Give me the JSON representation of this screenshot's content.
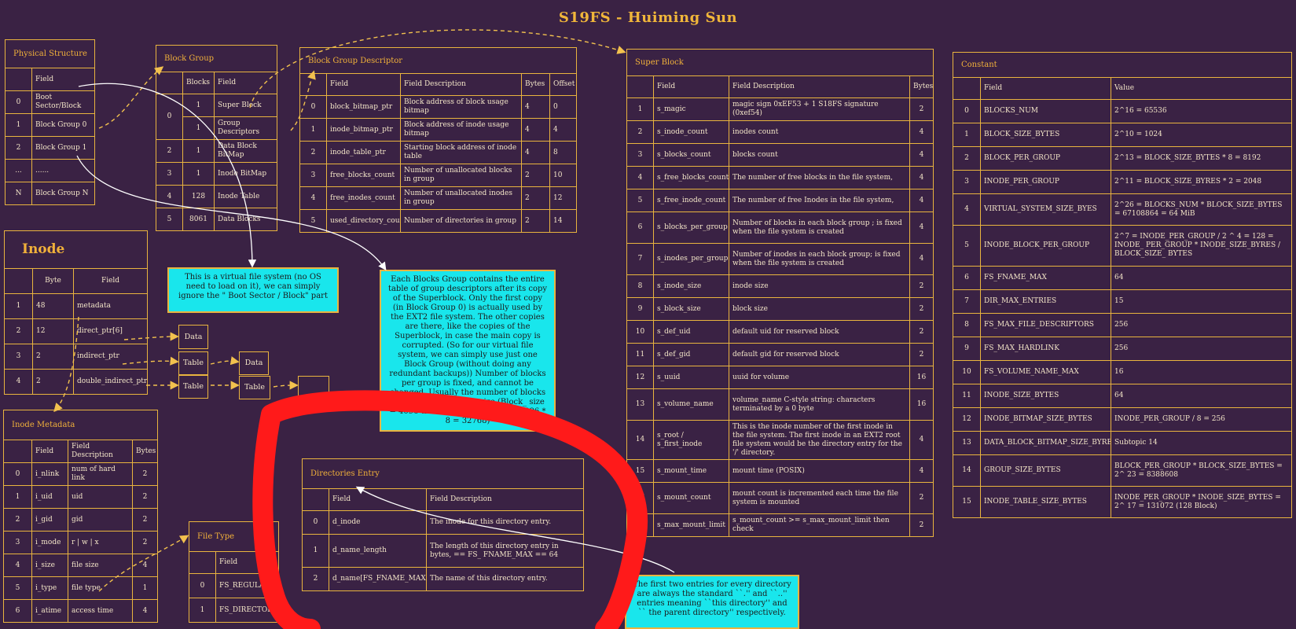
{
  "title": "S19FS - Huiming Sun",
  "physical": {
    "caption": "Physical Structure",
    "header": "Field",
    "rows": [
      {
        "idx": "0",
        "field": "Boot Sector/Block"
      },
      {
        "idx": "1",
        "field": "Block Group 0"
      },
      {
        "idx": "2",
        "field": "Block Group 1"
      },
      {
        "idx": "...",
        "field": "......"
      },
      {
        "idx": "N",
        "field": "Block Group N"
      }
    ]
  },
  "block_group": {
    "caption": "Block Group",
    "h_blocks": "Blocks",
    "h_field": "Field",
    "rows": [
      {
        "idx": "0",
        "blocks": "1",
        "field": "Super Block"
      },
      {
        "idx": "",
        "blocks": "1",
        "field": "Group Descriptors"
      },
      {
        "idx": "2",
        "blocks": "1",
        "field": "Data Block BitMap"
      },
      {
        "idx": "3",
        "blocks": "1",
        "field": "Inode BitMap"
      },
      {
        "idx": "4",
        "blocks": "128",
        "field": "Inode Table"
      },
      {
        "idx": "5",
        "blocks": "8061",
        "field": "Data Blocks"
      }
    ]
  },
  "bgd": {
    "caption": "Block Group Descriptor",
    "h_field": "Field",
    "h_desc": "Field Description",
    "h_bytes": "Bytes",
    "h_offset": "Offset",
    "rows": [
      {
        "idx": "0",
        "field": "block_bitmap_ptr",
        "desc": "Block address of block usage bitmap",
        "bytes": "4",
        "offset": "0"
      },
      {
        "idx": "1",
        "field": "inode_bitmap_ptr",
        "desc": "Block address of inode usage bitmap",
        "bytes": "4",
        "offset": "4"
      },
      {
        "idx": "2",
        "field": "inode_table_ptr",
        "desc": "Starting block address of inode table",
        "bytes": "4",
        "offset": "8"
      },
      {
        "idx": "3",
        "field": "free_blocks_count",
        "desc": "Number of unallocated blocks in group",
        "bytes": "2",
        "offset": "10"
      },
      {
        "idx": "4",
        "field": "free_inodes_count",
        "desc": "Number of unallocated inodes in group",
        "bytes": "2",
        "offset": "12"
      },
      {
        "idx": "5",
        "field": "used_directory_count",
        "desc": "Number of directories in group",
        "bytes": "2",
        "offset": "14"
      }
    ]
  },
  "super_block": {
    "caption": "Super Block",
    "h_field": "Field",
    "h_desc": "Field Description",
    "h_bytes": "Bytes",
    "rows": [
      {
        "idx": "1",
        "field": "s_magic",
        "desc": "magic sign 0xEF53 + 1 S18FS signature (0xef54)",
        "bytes": "2"
      },
      {
        "idx": "2",
        "field": "s_inode_count",
        "desc": "inodes count",
        "bytes": "4"
      },
      {
        "idx": "3",
        "field": "s_blocks_count",
        "desc": "blocks count",
        "bytes": "4"
      },
      {
        "idx": "4",
        "field": "s_free_blocks_count",
        "desc": "The number of free blocks in the file system,",
        "bytes": "4"
      },
      {
        "idx": "5",
        "field": "s_free_inode_count",
        "desc": "The number of free Inodes in the file system,",
        "bytes": "4"
      },
      {
        "idx": "6",
        "field": "s_blocks_per_group",
        "desc": "Number of blocks in each block group ; is fixed when the file system is created",
        "bytes": "4"
      },
      {
        "idx": "7",
        "field": "s_inodes_per_group",
        "desc": "Number of inodes in each block group; is fixed when the file system is created",
        "bytes": "4"
      },
      {
        "idx": "8",
        "field": "s_inode_size",
        "desc": "inode size",
        "bytes": "2"
      },
      {
        "idx": "9",
        "field": "s_block_size",
        "desc": "block size",
        "bytes": "2"
      },
      {
        "idx": "10",
        "field": "s_def_uid",
        "desc": "default uid for reserved block",
        "bytes": "2"
      },
      {
        "idx": "11",
        "field": "s_def_gid",
        "desc": "default gid for reserved block",
        "bytes": "2"
      },
      {
        "idx": "12",
        "field": "s_uuid",
        "desc": "uuid for volume",
        "bytes": "16"
      },
      {
        "idx": "13",
        "field": "s_volume_name",
        "desc": "volume_name C-style string: characters terminated by a 0 byte",
        "bytes": "16"
      },
      {
        "idx": "14",
        "field": "s_root / s_first_inode",
        "desc": "This is the inode number of the first inode in the file system. The first inode in an EXT2 root file system would be the directory entry for the '/' directory.",
        "bytes": "4"
      },
      {
        "idx": "15",
        "field": "s_mount_time",
        "desc": "mount time (POSIX)",
        "bytes": "4"
      },
      {
        "idx": "16",
        "field": "s_mount_count",
        "desc": "mount count is incremented each time the file system is mounted",
        "bytes": "2"
      },
      {
        "idx": "17",
        "field": "s_max_mount_limit",
        "desc": "s_mount_count >= s_max_mount_limit then check",
        "bytes": "2"
      }
    ]
  },
  "constant": {
    "caption": "Constant",
    "h_field": "Field",
    "h_value": "Value",
    "rows": [
      {
        "idx": "0",
        "field": "BLOCKS_NUM",
        "value": "2^16 = 65536"
      },
      {
        "idx": "1",
        "field": "BLOCK_SIZE_BYTES",
        "value": "2^10 = 1024"
      },
      {
        "idx": "2",
        "field": "BLOCK_PER_GROUP",
        "value": "2^13 = BLOCK_SIZE_BYTES * 8 = 8192"
      },
      {
        "idx": "3",
        "field": "INODE_PER_GROUP",
        "value": "2^11 = BLOCK_SIZE_BYRES * 2 = 2048"
      },
      {
        "idx": "4",
        "field": "VIRTUAL_SYSTEM_SIZE_BYES",
        "value": "2^26 = BLOCKS_NUM * BLOCK_SIZE_BYTES = 67108864 = 64 MiB"
      },
      {
        "idx": "5",
        "field": "INODE_BLOCK_PER_GROUP",
        "value": "2^7 = INODE_PER_GROUP / 2 ^ 4 = 128 = INODE_ PER_GROUP * INODE_SIZE_BYRES / BLOCK_SIZE_ BYTES"
      },
      {
        "idx": "6",
        "field": "FS_FNAME_MAX",
        "value": "64"
      },
      {
        "idx": "7",
        "field": "DIR_MAX_ENTRIES",
        "value": "15"
      },
      {
        "idx": "8",
        "field": "FS_MAX_FILE_DESCRIPTORS",
        "value": "256"
      },
      {
        "idx": "9",
        "field": "FS_MAX_HARDLINK",
        "value": "256"
      },
      {
        "idx": "10",
        "field": "FS_VOLUME_NAME_MAX",
        "value": "16"
      },
      {
        "idx": "11",
        "field": "INODE_SIZE_BYTES",
        "value": "64"
      },
      {
        "idx": "12",
        "field": "INODE_BITMAP_SIZE_BYTES",
        "value": "INODE_PER_GROUP / 8 = 256"
      },
      {
        "idx": "13",
        "field": "DATA_BLOCK_BITMAP_SIZE_BYRES",
        "value": "Subtopic 14"
      },
      {
        "idx": "14",
        "field": "GROUP_SIZE_BYTES",
        "value": "BLOCK_PER_GROUP * BLOCK_SIZE_BYTES = 2^ 23 = 8388608"
      },
      {
        "idx": "15",
        "field": "INODE_TABLE_SIZE_BYTES",
        "value": "INODE_PER_GROUP * INODE_SIZE_BYTES = 2^ 17 = 131072 (128 Block)"
      }
    ]
  },
  "inode": {
    "caption": "Inode",
    "h_byte": "Byte",
    "h_field": "Field",
    "rows": [
      {
        "idx": "1",
        "byte": "48",
        "field": "metadata"
      },
      {
        "idx": "2",
        "byte": "12",
        "field": "direct_ptr[6]"
      },
      {
        "idx": "3",
        "byte": "2",
        "field": "indirect_ptr"
      },
      {
        "idx": "4",
        "byte": "2",
        "field": "double_indirect_ptr"
      }
    ]
  },
  "inode_meta": {
    "caption": "Inode Metadata",
    "h_field": "Field",
    "h_desc": "Field Description",
    "h_bytes": "Bytes",
    "rows": [
      {
        "idx": "0",
        "field": "i_nlink",
        "desc": "num of hard link",
        "bytes": "2"
      },
      {
        "idx": "1",
        "field": "i_uid",
        "desc": "uid",
        "bytes": "2"
      },
      {
        "idx": "2",
        "field": "i_gid",
        "desc": "gid",
        "bytes": "2"
      },
      {
        "idx": "3",
        "field": "i_mode",
        "desc": "r | w | x",
        "bytes": "2"
      },
      {
        "idx": "4",
        "field": "i_size",
        "desc": "file size",
        "bytes": "4"
      },
      {
        "idx": "5",
        "field": "i_type",
        "desc": "file type",
        "bytes": "1"
      },
      {
        "idx": "6",
        "field": "i_atime",
        "desc": "access time",
        "bytes": "4"
      }
    ]
  },
  "file_type": {
    "caption": "File Type",
    "header": "Field",
    "rows": [
      {
        "idx": "0",
        "field": "FS_REGULAR"
      },
      {
        "idx": "1",
        "field": "FS_DIRECTORY"
      }
    ]
  },
  "dir_entry": {
    "caption": "Directories Entry",
    "h_field": "Field",
    "h_desc": "Field Description",
    "rows": [
      {
        "idx": "0",
        "field": "d_inode",
        "desc": "The inode for this directory entry."
      },
      {
        "idx": "1",
        "field": "d_name_length",
        "desc": "The length of this directory entry in bytes, == FS_ FNAME_MAX == 64"
      },
      {
        "idx": "2",
        "field": "d_name[FS_FNAME_MAX]",
        "desc": "The name of this directory entry."
      }
    ]
  },
  "notes": {
    "virtual_fs": "This is a virtual file system (no OS need to load on it), we can simply ignore the \" Boot Sector / Block\" part",
    "block_group": "Each Blocks Group contains the entire table of group descriptors after its copy of the Superblock. Only the first copy (in Block Group 0) is actually used by the EXT2 file system. The other copies are there, like the copies of the Superblock, in case the main copy is corrupted.  (So for our virtual file system, we can simply use just one Block Group (without doing any redundant backups)) Number of blocks per group is fixed, and cannot be changed. Usually the number of blocks per group is 8 * block size.(Block_ size = 4096 then block_per_group = 4096 * 8 = 32768)",
    "dir_entries": "The first two entries for every directory are always the standard ``.'' and ``..'' entries meaning ``this directory'' and `` the parent directory'' respectively."
  },
  "pointer_boxes": {
    "data": "Data",
    "table": "Table"
  },
  "colors": {
    "background": "#3a2244",
    "border": "#e9b43f",
    "title": "#f0b63a",
    "note_bg": "#19e6ec",
    "highlight_circle": "#ff1a1a"
  }
}
